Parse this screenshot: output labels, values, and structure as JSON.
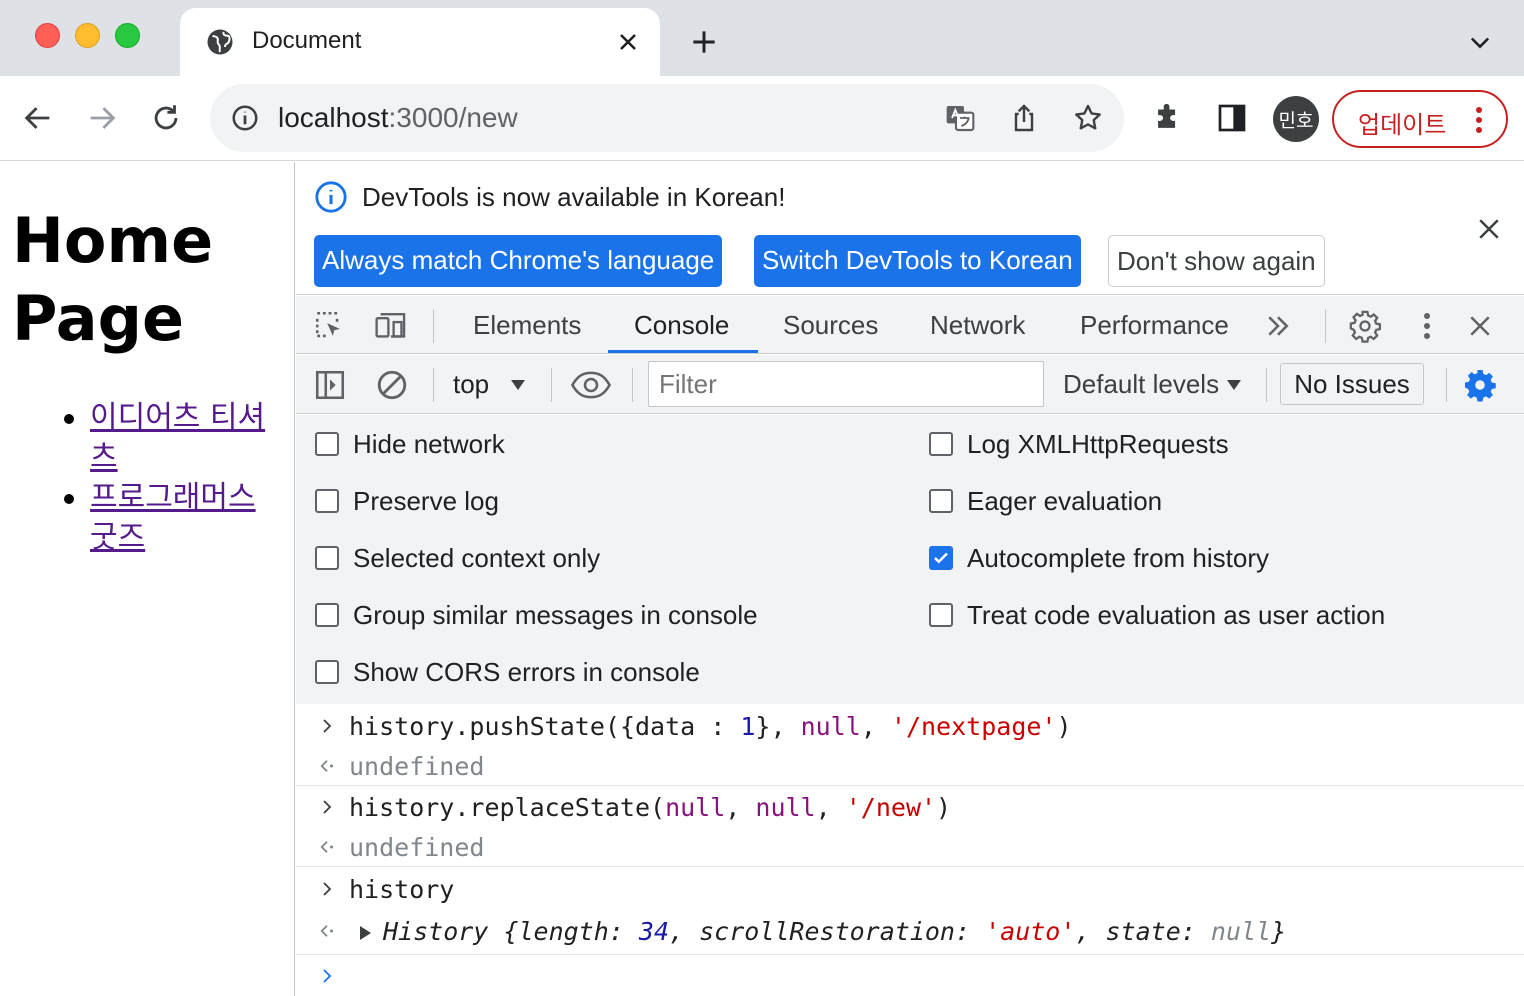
{
  "browser": {
    "tab": {
      "title": "Document"
    },
    "address": {
      "host": "localhost",
      "rest": ":3000/new"
    },
    "profile": {
      "initials": "민호"
    },
    "update_label": "업데이트"
  },
  "page": {
    "heading": "Home Page",
    "links": [
      "이디어츠 티셔츠",
      "프로그래머스 굿즈"
    ]
  },
  "devtools": {
    "infobar": {
      "message": "DevTools is now available in Korean!",
      "buttons": {
        "always_match": "Always match Chrome's language",
        "switch": "Switch DevTools to Korean",
        "dont_show": "Don't show again"
      }
    },
    "tabs": [
      "Elements",
      "Console",
      "Sources",
      "Network",
      "Performance"
    ],
    "active_tab": "Console",
    "console_toolbar": {
      "context": "top",
      "filter_placeholder": "Filter",
      "levels": "Default levels",
      "issues": "No Issues"
    },
    "settings": {
      "left": [
        {
          "label": "Hide network",
          "checked": false
        },
        {
          "label": "Preserve log",
          "checked": false
        },
        {
          "label": "Selected context only",
          "checked": false
        },
        {
          "label": "Group similar messages in console",
          "checked": false
        },
        {
          "label": "Show CORS errors in console",
          "checked": false
        }
      ],
      "right": [
        {
          "label": "Log XMLHttpRequests",
          "checked": false
        },
        {
          "label": "Eager evaluation",
          "checked": false
        },
        {
          "label": "Autocomplete from history",
          "checked": true
        },
        {
          "label": "Treat code evaluation as user action",
          "checked": false
        }
      ]
    },
    "console": {
      "entry1": {
        "fn": "history.pushState(",
        "obj_open": "{data : ",
        "num": "1",
        "obj_close": "}, ",
        "null1": "null",
        "comma": ", ",
        "str": "'/nextpage'",
        "close": ")",
        "result": "undefined"
      },
      "entry2": {
        "fn": "history.replaceState(",
        "null1": "null",
        "comma1": ", ",
        "null2": "null",
        "comma2": ", ",
        "str": "'/new'",
        "close": ")",
        "result": "undefined"
      },
      "entry3": {
        "input": "history",
        "obj_name": "History",
        "length_key": "length",
        "length_val": "34",
        "scroll_key": "scrollRestoration",
        "scroll_val": "'auto'",
        "state_key": "state",
        "state_val": "null"
      }
    },
    "colors": {
      "accent": "#1a73e8",
      "string": "#c80000",
      "number": "#1a1aa6",
      "keyword": "#881280"
    }
  }
}
